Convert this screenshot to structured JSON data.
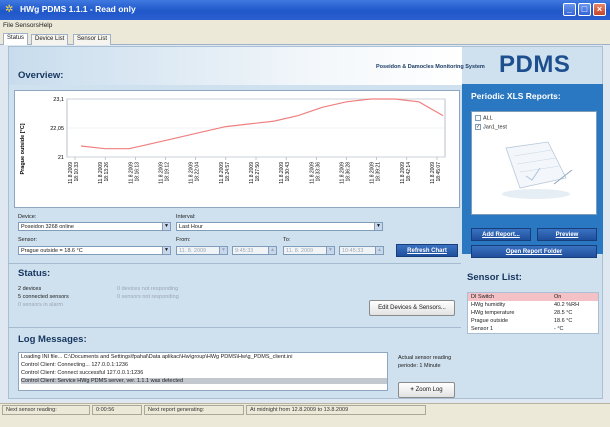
{
  "window": {
    "title": "HWg PDMS 1.1.1 - Read only"
  },
  "menu": [
    "File",
    "Sensors",
    "Help"
  ],
  "tabs": [
    "Status",
    "Device List",
    "Sensor List"
  ],
  "header": {
    "overview_title": "Overview:",
    "brand_subtitle": "Poseidon & Damocles Monitoring System",
    "brand": "PDMS"
  },
  "chart_data": {
    "type": "line",
    "ylabel": "Prague outside [°C]",
    "y_ticks": [
      "23,1",
      "22,05",
      "21"
    ],
    "ylim": [
      21,
      23.1
    ],
    "x": [
      "11.8.2009 18:10:33",
      "11.8.2009 18:13:26",
      "11.8.2009 18:16:13",
      "11.8.2009 18:19:12",
      "11.8.2009 18:22:04",
      "11.8.2009 18:24:57",
      "11.8.2009 18:27:50",
      "11.8.2009 18:30:43",
      "11.8.2009 18:33:36",
      "11.8.2009 18:36:28",
      "11.8.2009 18:39:21",
      "11.8.2009 18:42:14",
      "11.8.2009 18:45:07"
    ],
    "values": [
      21.4,
      21.3,
      21.3,
      21.5,
      21.7,
      21.9,
      22.1,
      22.2,
      22.3,
      22.5,
      22.8,
      23.0,
      23.1,
      23.1,
      23.0,
      22.5
    ],
    "line_color": "#f08080"
  },
  "controls": {
    "device_label": "Device:",
    "device_value": "Poseidon 3268 online",
    "interval_label": "Interval:",
    "interval_value": "Last Hour",
    "sensor_label": "Sensor:",
    "sensor_value": "Prague outside = 18.6 °C",
    "from_label": "From:",
    "from_date": "11. 8. 2009",
    "from_time": "9:45:33",
    "to_label": "To:",
    "to_date": "11. 8. 2009",
    "to_time": "10:45:33",
    "refresh_button": "Refresh Chart"
  },
  "status": {
    "title": "Status:",
    "devices": "2 devices",
    "sensors_connected": "5 connected sensors",
    "sensors_alarm": "0 sensors in alarm",
    "devices_not_responding": "0 devices not responding",
    "sensors_not_responding": "0 sensors not responding",
    "edit_button": "Edit Devices & Sensors..."
  },
  "log": {
    "title": "Log Messages:",
    "lines": [
      "Loading INI file... C:\\Documents and Settings\\fpahal\\Data aplikaci\\Hw\\group\\HWg PDMS\\Hw\\g_PDMS_client.ini",
      "Control Client: Connecting... 127.0.0.1:1236",
      "Control Client: Connect successful 127.0.0.1:1236",
      "Control Client: Service HWg PDMS server, ver. 1.1.1 was detected"
    ],
    "reading_period_label": "Actual sensor reading",
    "reading_period_value": "periode: 1 Minute",
    "zoom_button": "Zoom Log"
  },
  "reports": {
    "title": "Periodic XLS Reports:",
    "items": [
      {
        "label": "ALL",
        "checked": false
      },
      {
        "label": "Jan1_test",
        "checked": true
      }
    ],
    "add_button": "Add Report...",
    "preview_button": "Preview",
    "open_folder_button": "Open Report Folder"
  },
  "sensor_list": {
    "title": "Sensor List:",
    "rows": [
      {
        "name": "DI Switch",
        "value": "On",
        "alert": true
      },
      {
        "name": "HWg humidity",
        "value": "40.2 %RH",
        "alert": false
      },
      {
        "name": "HWg temperature",
        "value": "28.5 °C",
        "alert": false
      },
      {
        "name": "Prague outside",
        "value": "18.6 °C",
        "alert": false
      },
      {
        "name": "Sensor 1",
        "value": "- °C",
        "alert": false
      }
    ]
  },
  "statusbar": {
    "next_reading_label": "Next sensor reading:",
    "next_reading_value": "0:00:56",
    "next_report_label": "Next report generating:",
    "next_report_value": "At midnight from 12.8.2009 to 13.8.2009"
  }
}
